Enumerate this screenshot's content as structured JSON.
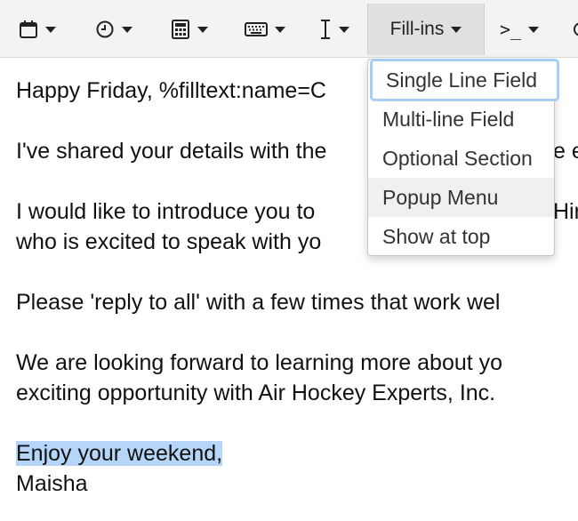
{
  "toolbar": {
    "buttons": [
      {
        "icon": "calendar-icon"
      },
      {
        "icon": "clock-icon"
      },
      {
        "icon": "calculator-icon"
      },
      {
        "icon": "keyboard-icon"
      },
      {
        "icon": "text-cursor-icon"
      },
      {
        "label": "Fill-ins"
      },
      {
        "icon": "terminal-icon",
        "glyph": ">_"
      }
    ]
  },
  "fillins_menu": {
    "items": [
      {
        "label": "Single Line Field",
        "state": "focused"
      },
      {
        "label": "Multi-line Field"
      },
      {
        "label": "Optional Section"
      },
      {
        "label": "Popup Menu",
        "state": "hover"
      },
      {
        "label": "Show at top"
      }
    ]
  },
  "editor": {
    "lines": [
      "Happy Friday, %filltext:name=C",
      "I've shared your details with the",
      "I would like to introduce you to",
      "who is excited to speak with yo",
      "Please 'reply to all' with a few times that work wel",
      "We are looking forward to learning more about yo",
      "exciting opportunity with Air Hockey Experts, Inc.",
      "Enjoy your weekend,",
      "Maisha"
    ],
    "fragment_after_menu_1": "e e",
    "fragment_after_menu_2": "Hir"
  },
  "colors": {
    "selection": "#b6d6f9",
    "focus_outline": "#a9cdf5",
    "toolbar_bg": "#f3f3f3"
  }
}
